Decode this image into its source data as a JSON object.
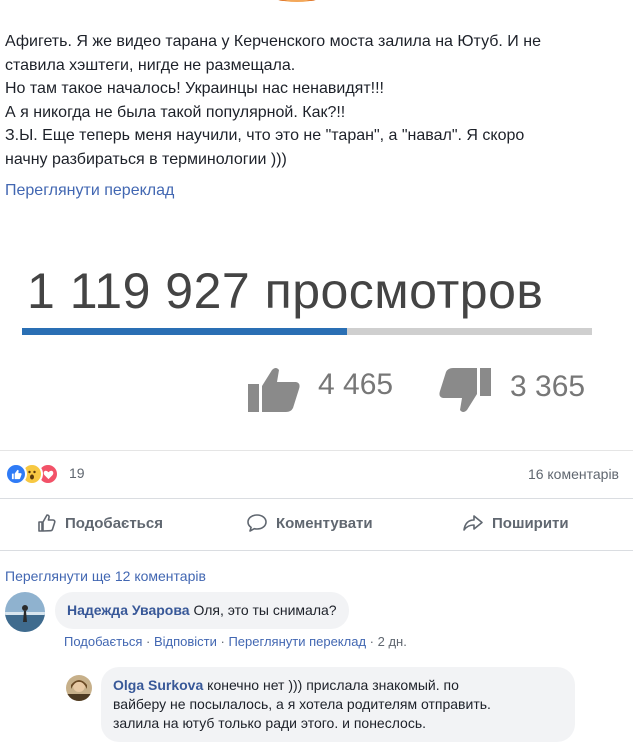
{
  "post": {
    "lines": [
      "Афигеть. Я же видео тарана у Керченского моста залила на Ютуб. И не",
      "ставила хэштеги, нигде не размещала.",
      "Но там такое началось! Украинцы нас ненавидят!!!",
      "А я никогда не была такой популярной. Как?!!",
      "З.Ы. Еще теперь меня научили, что это не \"таран\", а \"навал\". Я скоро",
      "начну разбираться в терминологии )))"
    ],
    "see_translation": "Переглянути переклад"
  },
  "embed": {
    "views": "1 119 927 просмотров",
    "progress_fraction": 0.57,
    "likes": "4 465",
    "dislikes": "3 365"
  },
  "reactions": {
    "count": "19",
    "comments": "16 коментарів",
    "icons": [
      "like-icon",
      "wow-icon",
      "love-icon"
    ]
  },
  "actions": {
    "like": "Подобається",
    "comment": "Коментувати",
    "share": "Поширити"
  },
  "comments": {
    "more": "Переглянути ще 12 коментарів",
    "items": [
      {
        "author": "Надежда Уварова",
        "text": "Оля, это ты снимала?",
        "like": "Подобається",
        "reply": "Відповісти",
        "translate": "Переглянути переклад",
        "time": "2 дн."
      },
      {
        "author": "Olga Surkova",
        "text_lines": [
          "конечно нет ))) прислала знакомый. по",
          "вайберу не посылалось, а я хотела родителям отправить.",
          "залила на ютуб только ради этого. и понеслось."
        ]
      }
    ]
  },
  "colors": {
    "link": "#4267b2",
    "name": "#385898",
    "bar": "#2a6fb4"
  }
}
